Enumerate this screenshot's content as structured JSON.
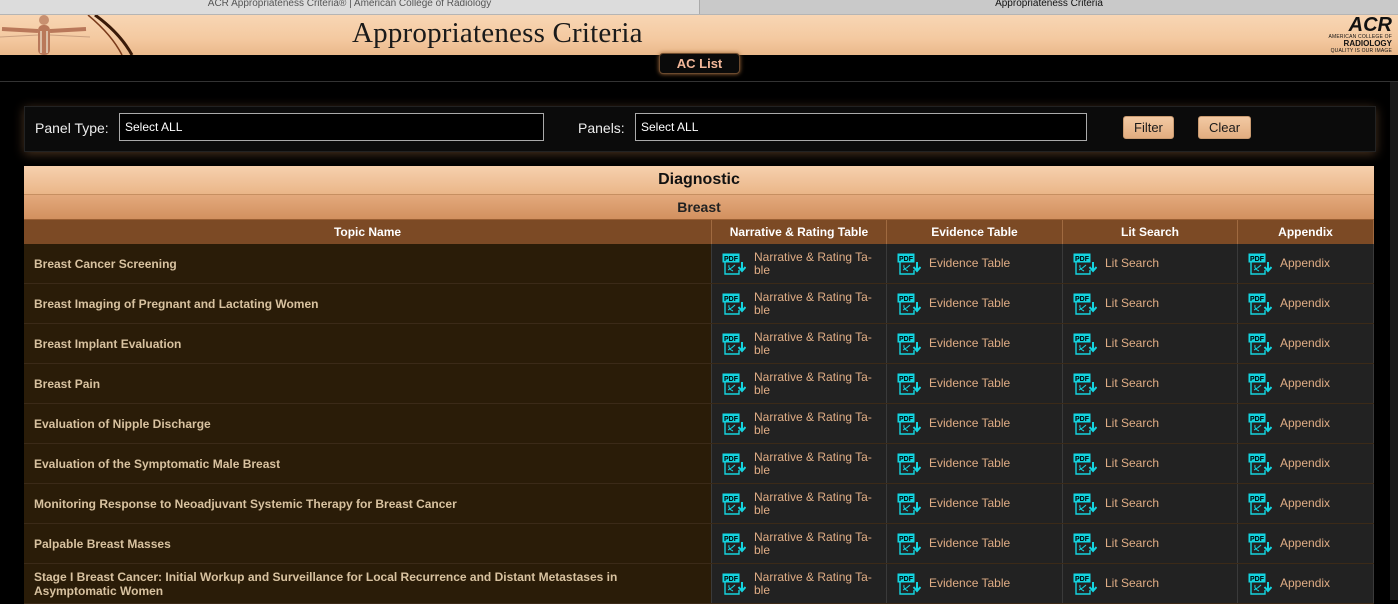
{
  "browser": {
    "tabs": [
      {
        "label": "ACR Appropriateness Criteria® | American College of Radiology"
      },
      {
        "label": "Appropriateness Criteria"
      }
    ]
  },
  "header": {
    "title": "Appropriateness Criteria",
    "logo_main": "ACR",
    "logo_line1": "AMERICAN COLLEGE OF",
    "logo_line2": "RADIOLOGY",
    "logo_line3": "QUALITY IS OUR IMAGE"
  },
  "nav": {
    "aclist_label": "AC List"
  },
  "filters": {
    "panel_type_label": "Panel Type:",
    "panel_type_value": "Select ALL",
    "panels_label": "Panels:",
    "panels_value": "Select ALL",
    "filter_button": "Filter",
    "clear_button": "Clear"
  },
  "table": {
    "category": "Diagnostic",
    "subcategory": "Breast",
    "columns": [
      "Topic Name",
      "Narrative & Rating Table",
      "Evidence Table",
      "Lit Search",
      "Appendix"
    ],
    "link_labels": {
      "narrative_line1": "Narrative & Rating Ta-",
      "narrative_line2": "ble",
      "evidence": "Evidence Table",
      "lit": "Lit Search",
      "appendix": "Appendix"
    },
    "rows": [
      "Breast Cancer Screening",
      "Breast Imaging of Pregnant and Lactating Women",
      "Breast Implant Evaluation",
      "Breast Pain",
      "Evaluation of Nipple Discharge",
      "Evaluation of the Symptomatic Male Breast",
      "Monitoring Response to Neoadjuvant Systemic Therapy for Breast Cancer",
      "Palpable Breast Masses",
      "Stage I Breast Cancer: Initial Workup and Surveillance for Local Recurrence and Distant Metastases in Asymptomatic Women"
    ]
  },
  "colors": {
    "accent": "#e0ad85",
    "header_bar": "#7c4a25",
    "topic_bg": "#2a1c08",
    "pdf_icon": "#14d4e0"
  }
}
